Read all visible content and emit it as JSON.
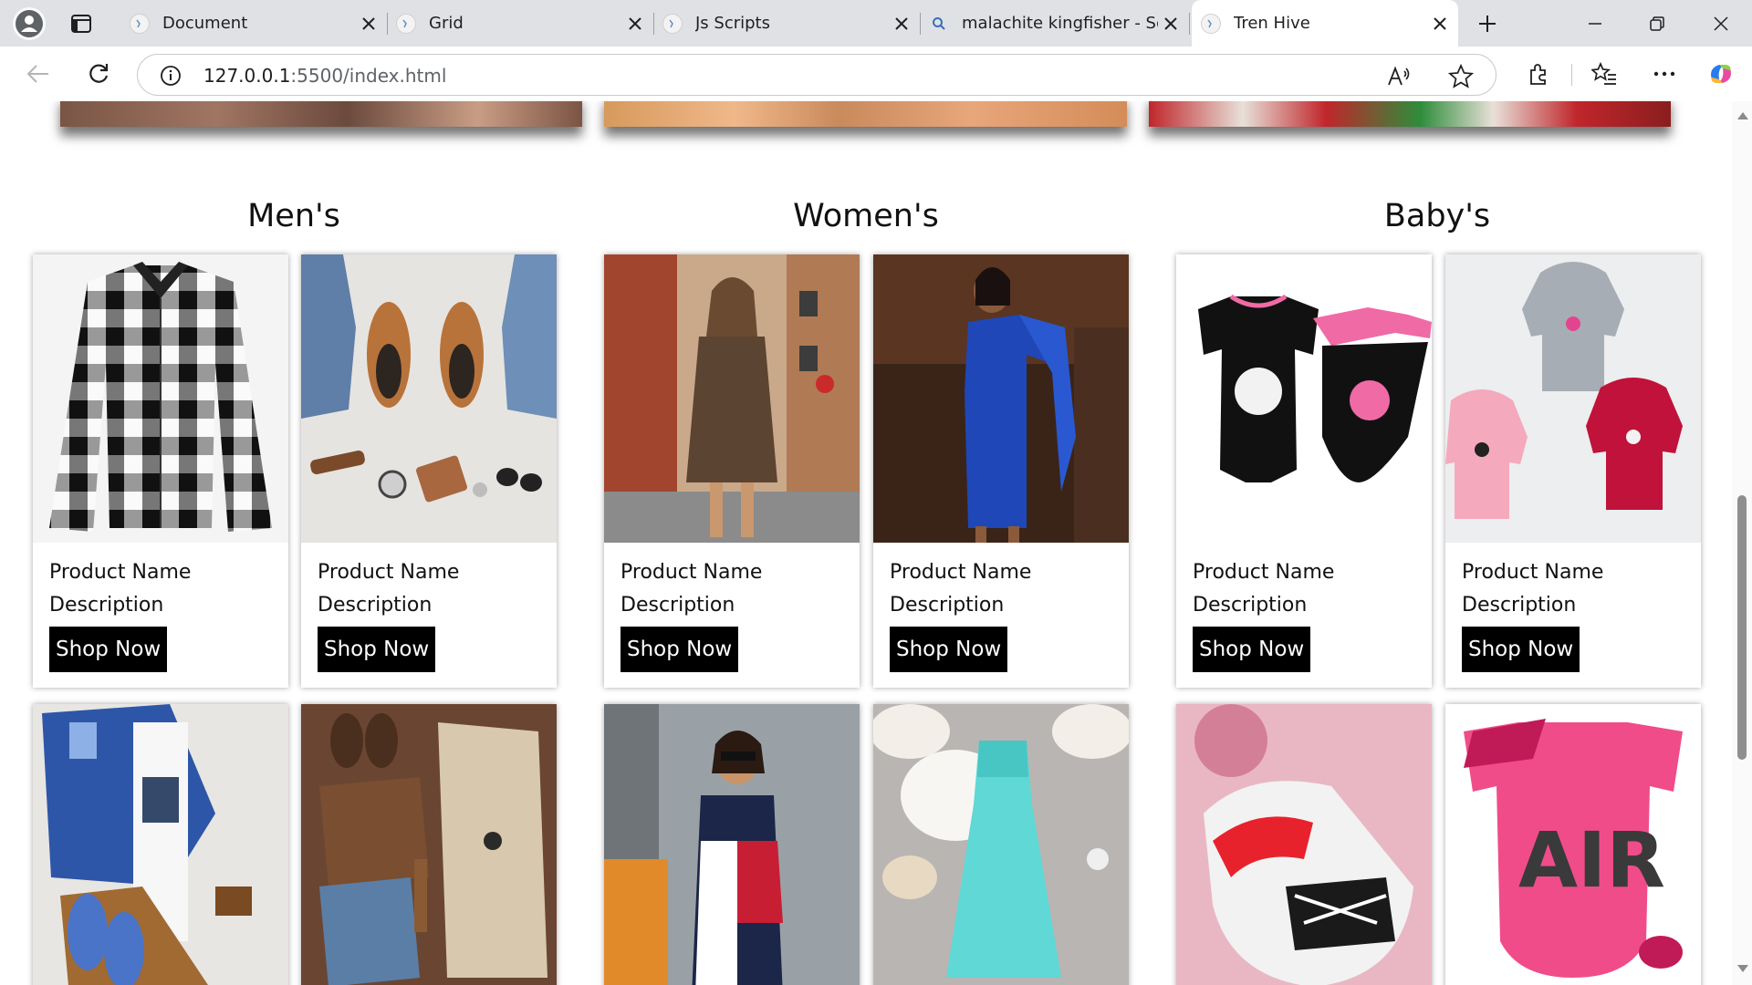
{
  "browser": {
    "tabs": [
      {
        "title": "Document"
      },
      {
        "title": "Grid"
      },
      {
        "title": "Js Scripts"
      },
      {
        "title": "malachite kingfisher - Search"
      },
      {
        "title": "Tren Hive"
      }
    ],
    "url_host": "127.0.0.1",
    "url_rest": ":5500/index.html"
  },
  "categories": [
    {
      "title": "Men's"
    },
    {
      "title": "Women's"
    },
    {
      "title": "Baby's"
    }
  ],
  "products": [
    {
      "name": "Product Name",
      "description": "Description",
      "button": "Shop Now",
      "image": "mens-plaid-shirt"
    },
    {
      "name": "Product Name",
      "description": "Description",
      "button": "Shop Now",
      "image": "mens-jeans-shoes-flatlay"
    },
    {
      "name": "Product Name",
      "description": "Description",
      "button": "Shop Now",
      "image": "womens-leopard-dress"
    },
    {
      "name": "Product Name",
      "description": "Description",
      "button": "Shop Now",
      "image": "womens-blue-dress"
    },
    {
      "name": "Product Name",
      "description": "Description",
      "button": "Shop Now",
      "image": "baby-jordan-bodysuit-set"
    },
    {
      "name": "Product Name",
      "description": "Description",
      "button": "Shop Now",
      "image": "baby-jordan-hoodies"
    }
  ],
  "colors": {
    "tabstrip": "#dfe1e5",
    "button_bg": "#000000",
    "button_text": "#ffffff"
  }
}
